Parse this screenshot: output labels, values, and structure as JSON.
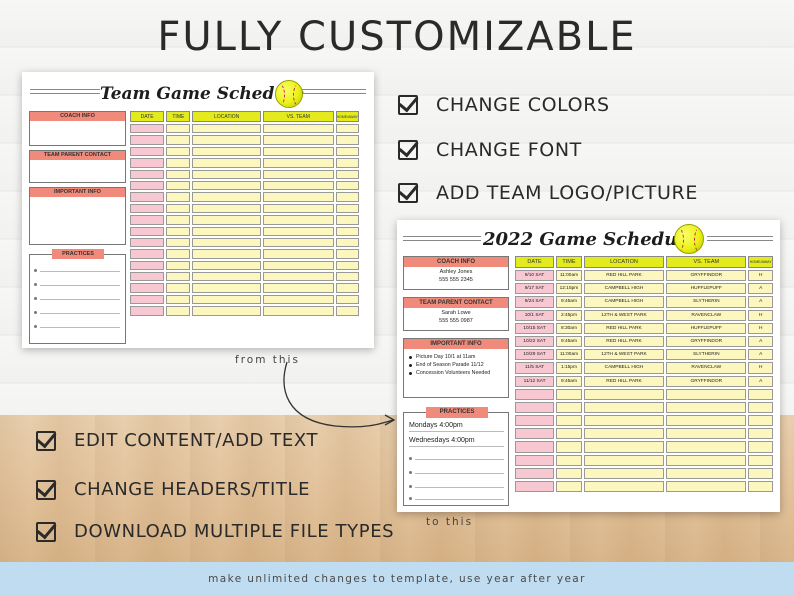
{
  "headline": "FULLY CUSTOMIZABLE",
  "features_top": [
    {
      "label": "CHANGE COLORS"
    },
    {
      "label": "CHANGE FONT"
    },
    {
      "label": "ADD TEAM LOGO/PICTURE"
    }
  ],
  "features_bottom": [
    {
      "label": "EDIT CONTENT/ADD TEXT"
    },
    {
      "label": "CHANGE HEADERS/TITLE"
    },
    {
      "label": "DOWNLOAD MULTIPLE FILE TYPES"
    }
  ],
  "captions": {
    "from": "from this",
    "to": "to this"
  },
  "footer": "make unlimited changes to template, use year after year",
  "template_sheet": {
    "title": "Team Game Schedule",
    "coach_info": "COACH INFO",
    "parent_contact": "TEAM PARENT CONTACT",
    "important_info": "IMPORTANT INFO",
    "practices": "PRACTICES",
    "columns": [
      "DATE",
      "TIME",
      "LOCATION",
      "VS. TEAM",
      "HOME/AWAY"
    ]
  },
  "custom_sheet": {
    "title": "2022 Game Schedule",
    "coach_info": {
      "header": "COACH INFO",
      "lines": [
        "Ashley Jones",
        "555 555 2345"
      ]
    },
    "parent_contact": {
      "header": "TEAM PARENT CONTACT",
      "lines": [
        "Sarah Lowe",
        "555 555 0987"
      ]
    },
    "important_info": {
      "header": "IMPORTANT INFO",
      "items": [
        "Picture Day 10/1 at 11am",
        "End of Season Parade 11/12",
        "Concession Volunteers Needed"
      ]
    },
    "practices": {
      "header": "PRACTICES",
      "items": [
        "Mondays 4:00pm",
        "Wednesdays 4:00pm"
      ]
    },
    "columns": [
      "DATE",
      "TIME",
      "LOCATION",
      "VS. TEAM",
      "HOME/AWAY"
    ],
    "rows": [
      [
        "9/10 SAT",
        "11:00am",
        "RED HILL PARK",
        "GRYFFINDOR",
        "H"
      ],
      [
        "9/17 SAT",
        "12:15pm",
        "CAMPBELL HIGH",
        "HUFFLEPUFF",
        "A"
      ],
      [
        "9/24 SAT",
        "9:45am",
        "CAMPBELL HIGH",
        "SLYTHERIN",
        "A"
      ],
      [
        "10/1 SAT",
        "2:45pm",
        "12TH & WEST PARK",
        "RAVENCLAW",
        "H"
      ],
      [
        "10/15 SAT",
        "8:30am",
        "RED HILL PARK",
        "HUFFLEPUFF",
        "H"
      ],
      [
        "10/22 SAT",
        "9:45am",
        "RED HILL PARK",
        "GRYFFINDOR",
        "A"
      ],
      [
        "10/29 SAT",
        "11:00am",
        "12TH & WEST PARK",
        "SLYTHERIN",
        "A"
      ],
      [
        "11/5 SAT",
        "1:15pm",
        "CAMPBELL HIGH",
        "RAVENCLAW",
        "H"
      ],
      [
        "11/12 SAT",
        "9:45am",
        "RED HILL PARK",
        "GRYFFINDOR",
        "A"
      ]
    ]
  },
  "colors": {
    "header_yellow": "#e3ea1e",
    "header_coral": "#f08a7a",
    "cell_pink": "#f7c8d2",
    "cell_yellow": "#fbf7bf",
    "footer_blue": "#bfdcf0"
  }
}
